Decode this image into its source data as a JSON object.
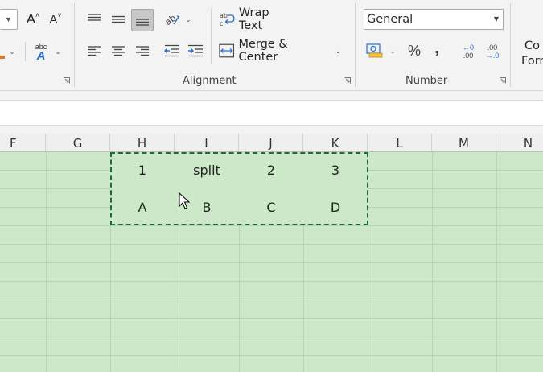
{
  "ribbon": {
    "font_group": {
      "increase_font_label": "A",
      "decrease_font_label": "A",
      "phonetic_top": "abc",
      "phonetic_bottom": "A"
    },
    "alignment": {
      "label": "Alignment",
      "wrap_text_label": "Wrap Text",
      "merge_center_label": "Merge & Center"
    },
    "number": {
      "label": "Number",
      "format_value": "General",
      "percent_label": "%",
      "comma_label": ",",
      "increase_decimal_top": "←0",
      "increase_decimal_bottom": ".00",
      "decrease_decimal_top": ".00",
      "decrease_decimal_bottom": "→.0"
    },
    "styles": {
      "conditional_line1": "Co",
      "conditional_line2": "Forr"
    }
  },
  "columns": [
    "F",
    "G",
    "H",
    "I",
    "J",
    "K",
    "L",
    "M",
    "N"
  ],
  "cells": [
    [
      "1",
      "split",
      "2",
      "3"
    ],
    [
      "A",
      "B",
      "C",
      "D"
    ]
  ],
  "colors": {
    "selection_fill": "#cde8c8",
    "marching_ants": "#1c6b3a",
    "ribbon_bg": "#f3f3f3"
  }
}
